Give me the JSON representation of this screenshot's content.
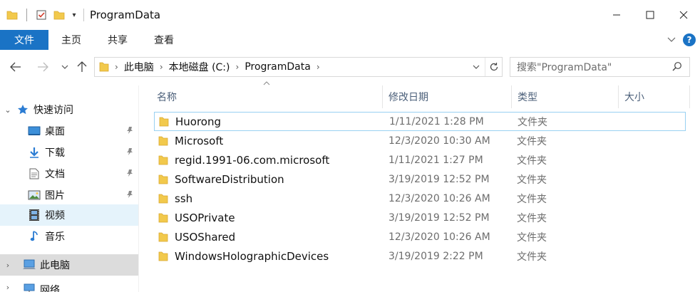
{
  "window": {
    "title": "ProgramData",
    "controls": {
      "minimize": "minimize-icon",
      "maximize": "maximize-icon",
      "close": "close-icon"
    }
  },
  "ribbon": {
    "tabs": [
      {
        "label": "文件",
        "active": true
      },
      {
        "label": "主页"
      },
      {
        "label": "共享"
      },
      {
        "label": "查看"
      }
    ],
    "help": "?"
  },
  "address": {
    "crumbs": [
      "此电脑",
      "本地磁盘 (C:)",
      "ProgramData"
    ],
    "search_placeholder": "搜索\"ProgramData\""
  },
  "sidebar": {
    "quick_access": "快速访问",
    "items": [
      {
        "label": "桌面",
        "pinned": true
      },
      {
        "label": "下载",
        "pinned": true
      },
      {
        "label": "文档",
        "pinned": true
      },
      {
        "label": "图片",
        "pinned": true
      },
      {
        "label": "视频",
        "pinned": false
      },
      {
        "label": "音乐",
        "pinned": false
      }
    ],
    "this_pc": "此电脑",
    "network": "网络"
  },
  "columns": {
    "name": "名称",
    "modified": "修改日期",
    "type": "类型",
    "size": "大小"
  },
  "files": [
    {
      "name": "Huorong",
      "modified": "1/11/2021 1:28 PM",
      "type": "文件夹"
    },
    {
      "name": "Microsoft",
      "modified": "12/3/2020 10:30 AM",
      "type": "文件夹"
    },
    {
      "name": "regid.1991-06.com.microsoft",
      "modified": "1/11/2021 1:27 PM",
      "type": "文件夹"
    },
    {
      "name": "SoftwareDistribution",
      "modified": "3/19/2019 12:52 PM",
      "type": "文件夹"
    },
    {
      "name": "ssh",
      "modified": "12/3/2020 10:26 AM",
      "type": "文件夹"
    },
    {
      "name": "USOPrivate",
      "modified": "3/19/2019 12:52 PM",
      "type": "文件夹"
    },
    {
      "name": "USOShared",
      "modified": "12/3/2020 10:26 AM",
      "type": "文件夹"
    },
    {
      "name": "WindowsHolographicDevices",
      "modified": "3/19/2019 2:22 PM",
      "type": "文件夹"
    }
  ],
  "colors": {
    "accent": "#1a73c5",
    "folder": "#f2c94c",
    "selection": "#e5f3fb"
  }
}
